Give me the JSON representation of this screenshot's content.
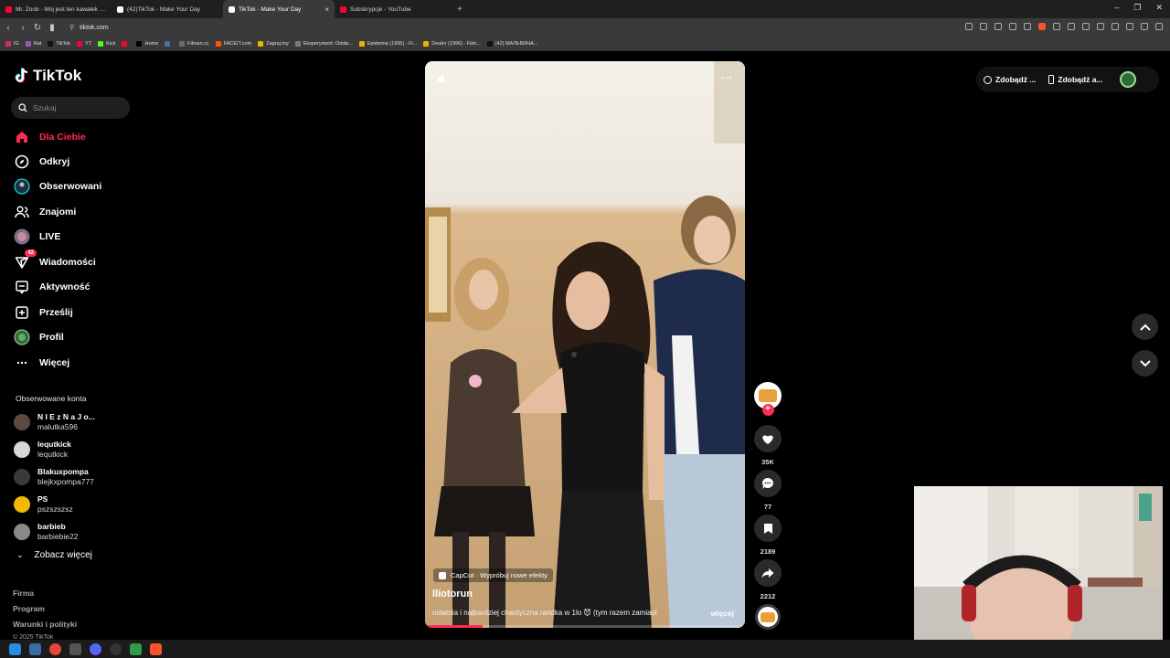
{
  "browser": {
    "tabs": [
      {
        "label": "Mr. Zoob - Mój jest ten kawałek podłogi",
        "color": "#ff0033",
        "active": false
      },
      {
        "label": "(42)TikTok - Make Your Day",
        "color": "#ffffff",
        "active": false
      },
      {
        "label": "TikTok - Make Your Day",
        "color": "#ffffff",
        "active": true
      },
      {
        "label": "Subskrypcje - YouTube",
        "color": "#ff0033",
        "active": false
      }
    ],
    "url": "tiktok.com",
    "bookmarks": [
      {
        "label": "IG",
        "color": "#d62976"
      },
      {
        "label": "Rat",
        "color": "#9b59b6"
      },
      {
        "label": "TikTok",
        "color": "#111111"
      },
      {
        "label": "YT",
        "color": "#ff0033"
      },
      {
        "label": "Kick",
        "color": "#53fc18"
      },
      {
        "label": "",
        "color": "#ff0033"
      },
      {
        "label": "Home",
        "color": "#000000"
      },
      {
        "label": "",
        "color": "#4a6fa5"
      },
      {
        "label": "Filman.cc",
        "color": "#6c6c6c"
      },
      {
        "label": "FACEIT.com",
        "color": "#ff5500"
      },
      {
        "label": "Zagraj.my",
        "color": "#e6b400"
      },
      {
        "label": "Eksperyment: Odsła...",
        "color": "#7a7a7a"
      },
      {
        "label": "Epidemia (1995) - Fi...",
        "color": "#e6b400"
      },
      {
        "label": "Dealer (1996) - Film...",
        "color": "#e6b400"
      },
      {
        "label": "(42) МАЛЬВИНА...",
        "color": "#111111"
      }
    ]
  },
  "tiktok": {
    "logo": "TikTok",
    "search_placeholder": "Szukaj",
    "nav": [
      {
        "label": "Dla Ciebie",
        "icon": "home-icon"
      },
      {
        "label": "Odkryj",
        "icon": "compass-icon"
      },
      {
        "label": "Obserwowani",
        "icon": "following-icon"
      },
      {
        "label": "Znajomi",
        "icon": "friends-icon"
      },
      {
        "label": "LIVE",
        "icon": "live-icon"
      },
      {
        "label": "Wiadomości",
        "icon": "messages-icon",
        "badge": "42"
      },
      {
        "label": "Aktywność",
        "icon": "activity-icon"
      },
      {
        "label": "Prześlij",
        "icon": "upload-icon"
      },
      {
        "label": "Profil",
        "icon": "profile-icon"
      },
      {
        "label": "Więcej",
        "icon": "more-icon"
      }
    ],
    "followed_title": "Obserwowane konta",
    "accounts": [
      {
        "name": "N I E z N a J o...",
        "user": "malutka596",
        "color": "#5a4a40"
      },
      {
        "name": "lequtkick",
        "user": "lequtkick",
        "color": "#d8d8d8"
      },
      {
        "name": "Blakuxpompa",
        "user": "blejkxpompa777",
        "color": "#3a3a3a"
      },
      {
        "name": "PS",
        "user": "pszszszsz",
        "color": "#f5b800"
      },
      {
        "name": "barbieb",
        "user": "barbiebie22",
        "color": "#8a8a8a"
      }
    ],
    "see_more": "Zobacz więcej",
    "footer": [
      "Firma",
      "Program",
      "Warunki i polityki",
      "© 2025 TikTok"
    ],
    "top_right": {
      "coins": "Zdobądź ...",
      "app": "Zdobądź a..."
    }
  },
  "video": {
    "effect": "CapCut · Wypróbuj nowe efekty",
    "author": "lliotorun",
    "description": "ostatnia i najbardziej chaotyczna randka w 1lo 😈 (tym razem zamiast",
    "more": "więcej",
    "progress": 0.18,
    "likes": "35K",
    "comments": "77",
    "saves": "2189",
    "shares": "2212"
  }
}
